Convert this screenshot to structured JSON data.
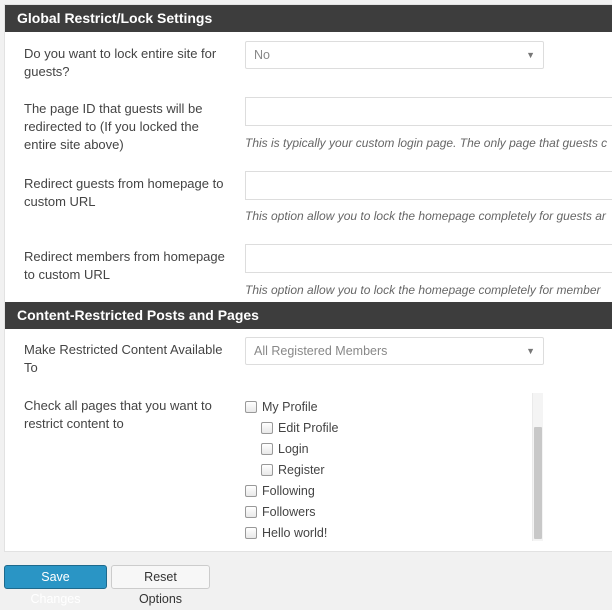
{
  "sections": {
    "global": {
      "title": "Global Restrict/Lock Settings"
    },
    "content": {
      "title": "Content-Restricted Posts and Pages"
    }
  },
  "fields": {
    "lock_site": {
      "label": "Do you want to lock entire site for guests?",
      "value": "No"
    },
    "guest_page_id": {
      "label": "The page ID that guests will be redirected to (If you locked the entire site above)",
      "value": "",
      "description": "This is typically your custom login page. The only page that guests c"
    },
    "guest_home_redirect": {
      "label": "Redirect guests from homepage to custom URL",
      "value": "",
      "description": "This option allow you to lock the homepage completely for guests ar"
    },
    "member_home_redirect": {
      "label": "Redirect members from homepage to custom URL",
      "value": "",
      "description": "This option allow you to lock the homepage completely for member"
    },
    "restricted_to": {
      "label": "Make Restricted Content Available To",
      "value": "All Registered Members"
    },
    "restrict_pages": {
      "label": "Check all pages that you want to restrict content to"
    }
  },
  "pages": [
    {
      "label": "My Profile",
      "checked": false,
      "indent": 0
    },
    {
      "label": "Edit Profile",
      "checked": false,
      "indent": 1
    },
    {
      "label": "Login",
      "checked": false,
      "indent": 1
    },
    {
      "label": "Register",
      "checked": false,
      "indent": 1
    },
    {
      "label": "Following",
      "checked": false,
      "indent": 0
    },
    {
      "label": "Followers",
      "checked": false,
      "indent": 0
    },
    {
      "label": "Hello world!",
      "checked": false,
      "indent": 0
    }
  ],
  "buttons": {
    "save": "Save Changes",
    "reset": "Reset Options"
  },
  "icons": {
    "dropdown": "chevron-down-icon",
    "checkbox": "checkbox-icon"
  },
  "colors": {
    "header_bg": "#3d3d3d",
    "primary": "#2a95c5"
  }
}
